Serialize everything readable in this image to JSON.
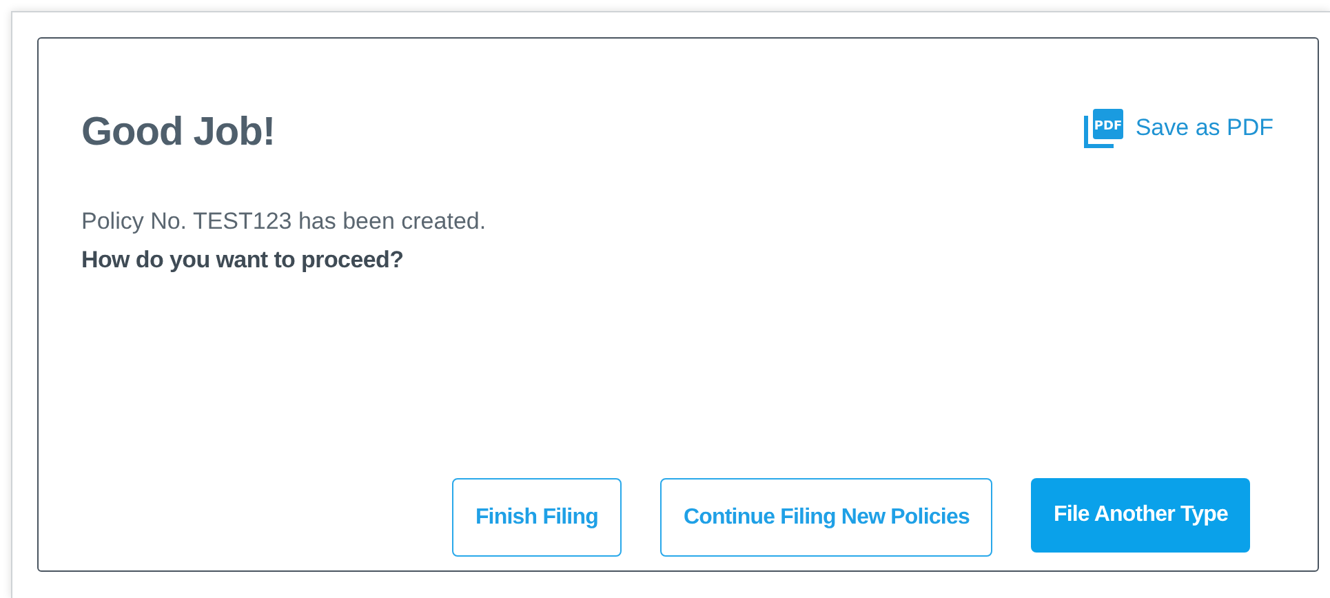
{
  "dialog": {
    "title": "Good Job!",
    "save_link": {
      "label": "Save as PDF",
      "icon_label": "PDF"
    },
    "message": "Policy No. TEST123 has been created.",
    "question": "How do you want to proceed?",
    "buttons": [
      {
        "label": "Finish Filing",
        "kind": "outline"
      },
      {
        "label": "Continue Filing New Policies",
        "kind": "outline"
      },
      {
        "label": "File Another Type",
        "kind": "filled"
      }
    ]
  }
}
